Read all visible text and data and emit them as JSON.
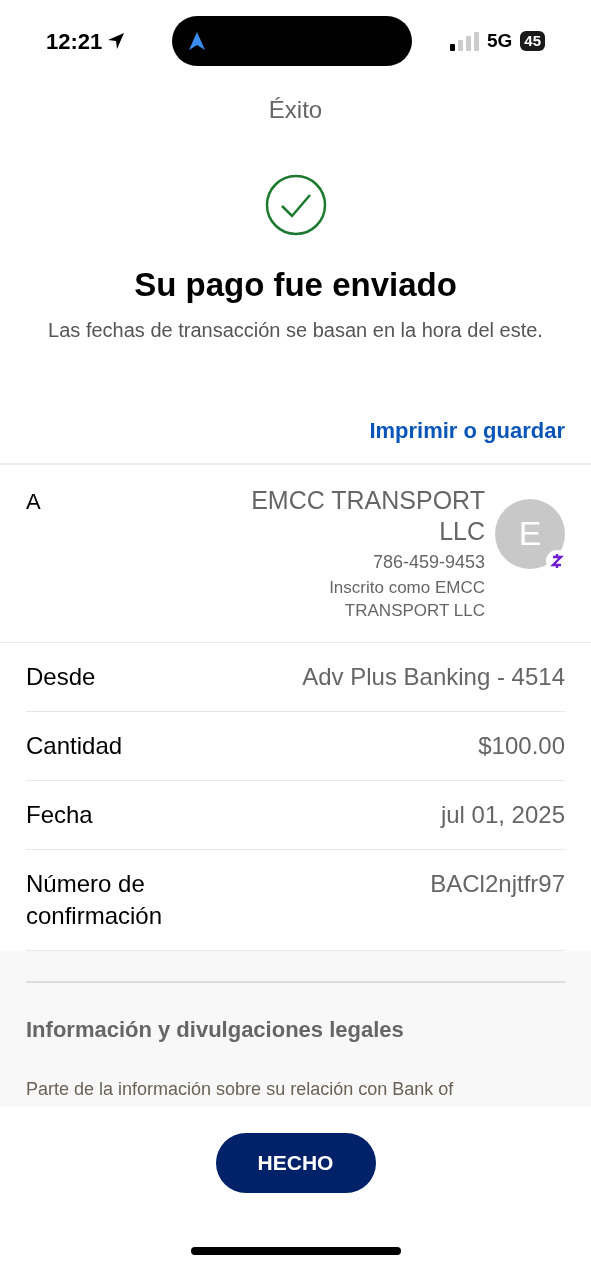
{
  "status_bar": {
    "time": "12:21",
    "network": "5G",
    "battery": "45"
  },
  "header": {
    "title": "Éxito"
  },
  "success": {
    "heading": "Su pago fue enviado",
    "note": "Las fechas de transacción se basan en la hora del este."
  },
  "print_link": "Imprimir o guardar",
  "recipient": {
    "label": "A",
    "name": "EMCC TRANSPORT LLC",
    "phone": "786-459-9453",
    "enrolled": "Inscrito como EMCC TRANSPORT LLC",
    "avatar_initial": "E"
  },
  "details": [
    {
      "label": "Desde",
      "value": "Adv Plus Banking - 4514"
    },
    {
      "label": "Cantidad",
      "value": "$100.00"
    },
    {
      "label": "Fecha",
      "value": "jul 01, 2025"
    },
    {
      "label": "Número de confirmación",
      "value": "BACl2njtfr97"
    }
  ],
  "legal": {
    "heading": "Información y divulgaciones legales",
    "text": "Parte de la información sobre su relación con Bank of"
  },
  "done_button": "HECHO"
}
